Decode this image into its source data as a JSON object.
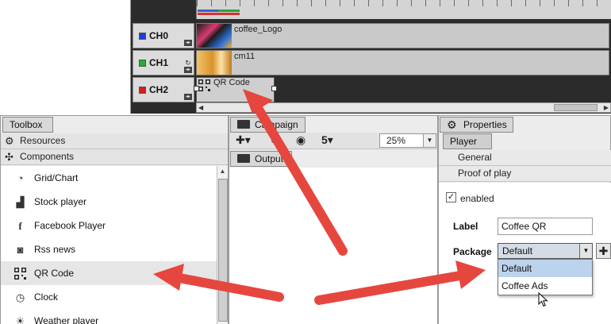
{
  "timeline": {
    "channels": [
      {
        "label": "CH0",
        "color": "#1f3fcf"
      },
      {
        "label": "CH1",
        "color": "#22b02a"
      },
      {
        "label": "CH2",
        "color": "#d61d1d"
      }
    ],
    "clips": {
      "ch0": "coffee_Logo",
      "ch1": "cm11",
      "ch2": "QR Code"
    }
  },
  "toolbox": {
    "tab": "Toolbox",
    "resources": "Resources",
    "components": "Components",
    "items": [
      {
        "label": "Grid/Chart",
        "icon": "pie-chart-icon"
      },
      {
        "label": "Stock player",
        "icon": "bar-chart-icon"
      },
      {
        "label": "Facebook Player",
        "icon": "facebook-icon"
      },
      {
        "label": "Rss news",
        "icon": "rss-icon"
      },
      {
        "label": "QR Code",
        "icon": "qr-code-icon"
      },
      {
        "label": "Clock",
        "icon": "clock-icon"
      },
      {
        "label": "Weather player",
        "icon": "weather-icon"
      }
    ]
  },
  "campaign": {
    "tab": "Campaign",
    "zoom": "25%",
    "output_tab": "Output"
  },
  "properties": {
    "tab": "Properties",
    "player_tab": "Player",
    "sections": [
      "General",
      "Proof of play"
    ],
    "enabled_label": "enabled",
    "enabled": true,
    "label_field_label": "Label",
    "label_value": "Coffee QR",
    "package_label": "Package",
    "package_value": "Default",
    "package_options": [
      "Default",
      "Coffee Ads"
    ]
  },
  "annotation_color": "#e5473f"
}
